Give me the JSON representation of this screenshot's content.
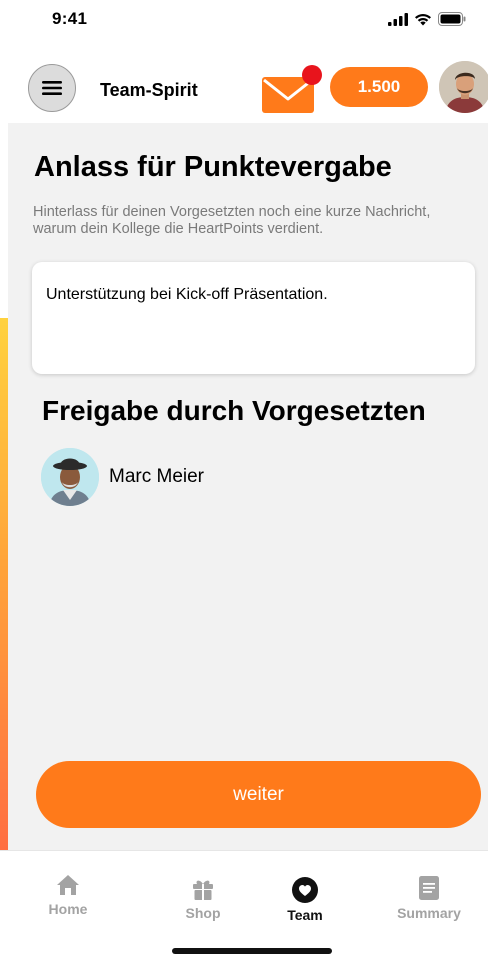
{
  "status_bar": {
    "time": "9:41"
  },
  "header": {
    "app_title": "Team-Spirit",
    "points": "1.500",
    "accent_color": "#ff7a1a",
    "notification_color": "#e8141c"
  },
  "content": {
    "section_title": "Anlass für Punktevergabe",
    "section_description": "Hinterlass für deinen Vorgesetzten noch eine kurze Nachricht, warum dein Kollege die HeartPoints verdient.",
    "reason_text": "Unterstützung bei Kick-off Präsentation.",
    "approval_title": "Freigabe durch Vorgesetzten",
    "supervisor_name": "Marc Meier",
    "next_button_label": "weiter"
  },
  "tab_bar": {
    "tabs": [
      {
        "label": "Home",
        "icon": "home-icon",
        "active": false
      },
      {
        "label": "Shop",
        "icon": "gift-icon",
        "active": false
      },
      {
        "label": "Team",
        "icon": "heart-icon",
        "active": true
      },
      {
        "label": "Summary",
        "icon": "document-icon",
        "active": false
      }
    ]
  }
}
